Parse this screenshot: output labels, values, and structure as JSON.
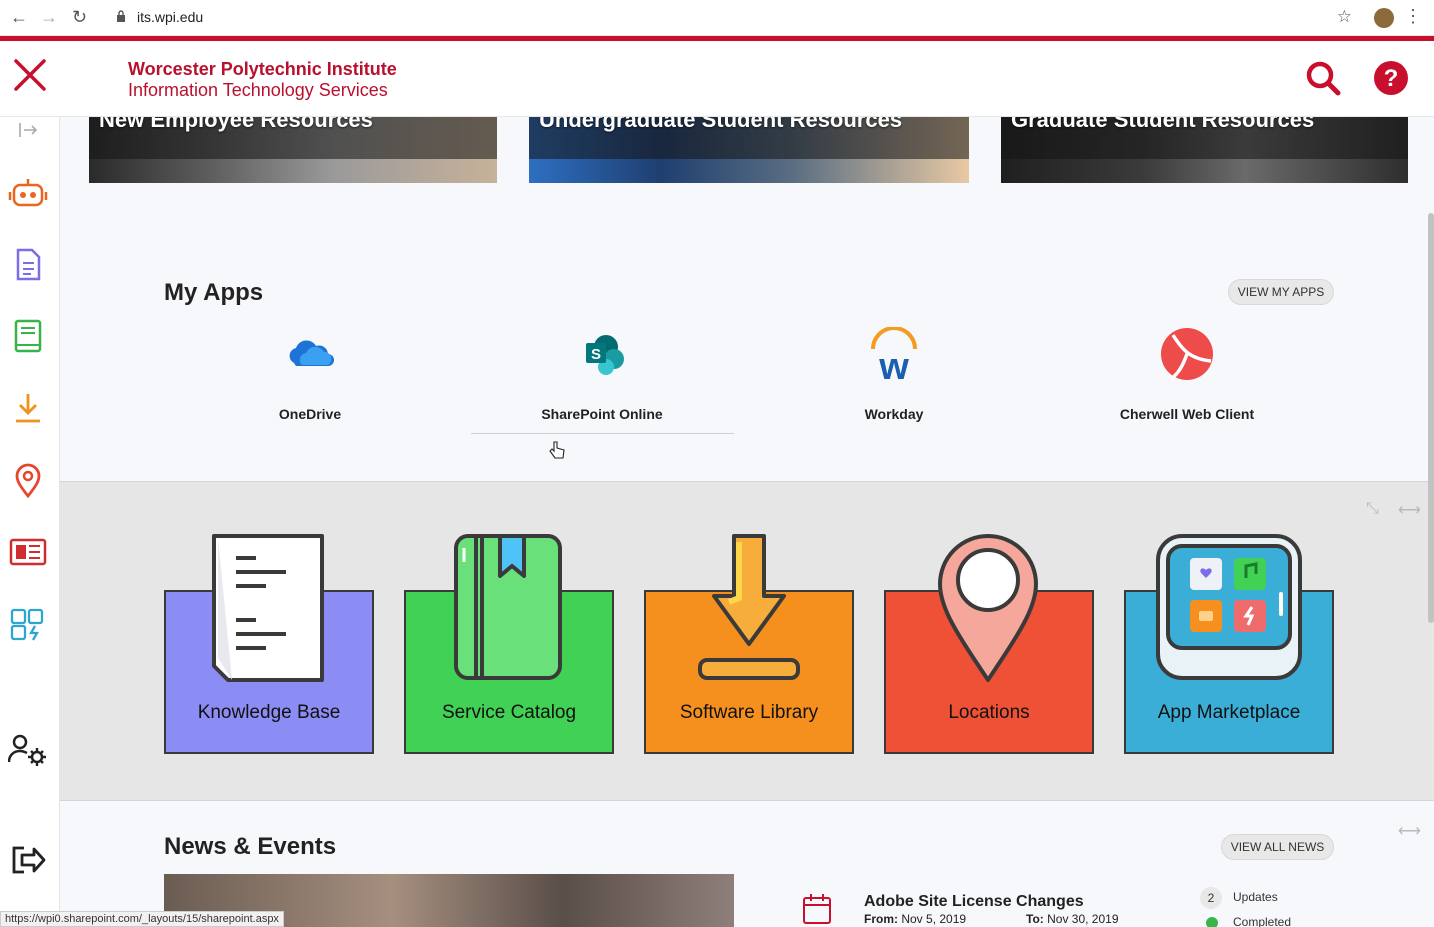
{
  "browser": {
    "url": "its.wpi.edu",
    "back_icon": "back-arrow-icon",
    "forward_icon": "forward-arrow-icon",
    "reload_icon": "reload-icon"
  },
  "header": {
    "institution": "Worcester Polytechnic Institute",
    "department": "Information Technology Services",
    "brand_color": "#b8102e"
  },
  "banners": [
    {
      "caption": "New Employee Resources"
    },
    {
      "caption": "Undergraduate Student Resources"
    },
    {
      "caption": "Graduate Student Resources"
    }
  ],
  "sidebar": {
    "items": [
      {
        "icon": "collapse-arrow-icon"
      },
      {
        "icon": "robot-icon"
      },
      {
        "icon": "document-icon"
      },
      {
        "icon": "book-icon"
      },
      {
        "icon": "download-icon"
      },
      {
        "icon": "location-pin-icon"
      },
      {
        "icon": "news-icon"
      },
      {
        "icon": "apps-icon"
      },
      {
        "icon": "user-settings-icon"
      },
      {
        "icon": "sign-out-icon"
      }
    ]
  },
  "my_apps": {
    "title": "My Apps",
    "view_button": "VIEW MY APPS",
    "apps": [
      {
        "label": "OneDrive",
        "icon": "onedrive-icon"
      },
      {
        "label": "SharePoint Online",
        "icon": "sharepoint-icon"
      },
      {
        "label": "Workday",
        "icon": "workday-icon"
      },
      {
        "label": "Cherwell Web Client",
        "icon": "cherwell-icon"
      }
    ]
  },
  "tiles": [
    {
      "label": "Knowledge Base",
      "color": "#8c8cf5"
    },
    {
      "label": "Service Catalog",
      "color": "#41d155"
    },
    {
      "label": "Software Library",
      "color": "#f5901f"
    },
    {
      "label": "Locations",
      "color": "#ef5136"
    },
    {
      "label": "App Marketplace",
      "color": "#3aaed6"
    }
  ],
  "news": {
    "title": "News & Events",
    "view_button": "VIEW ALL NEWS",
    "event": {
      "title": "Adobe Site License Changes",
      "from_label": "From:",
      "from_date": "Nov 5, 2019",
      "to_label": "To:",
      "to_date": "Nov 30, 2019"
    },
    "updates_count": "2",
    "updates_label": "Updates",
    "completed_label": "Completed"
  },
  "status_bar": {
    "link": "https://wpi0.sharepoint.com/_layouts/15/sharepoint.aspx"
  }
}
